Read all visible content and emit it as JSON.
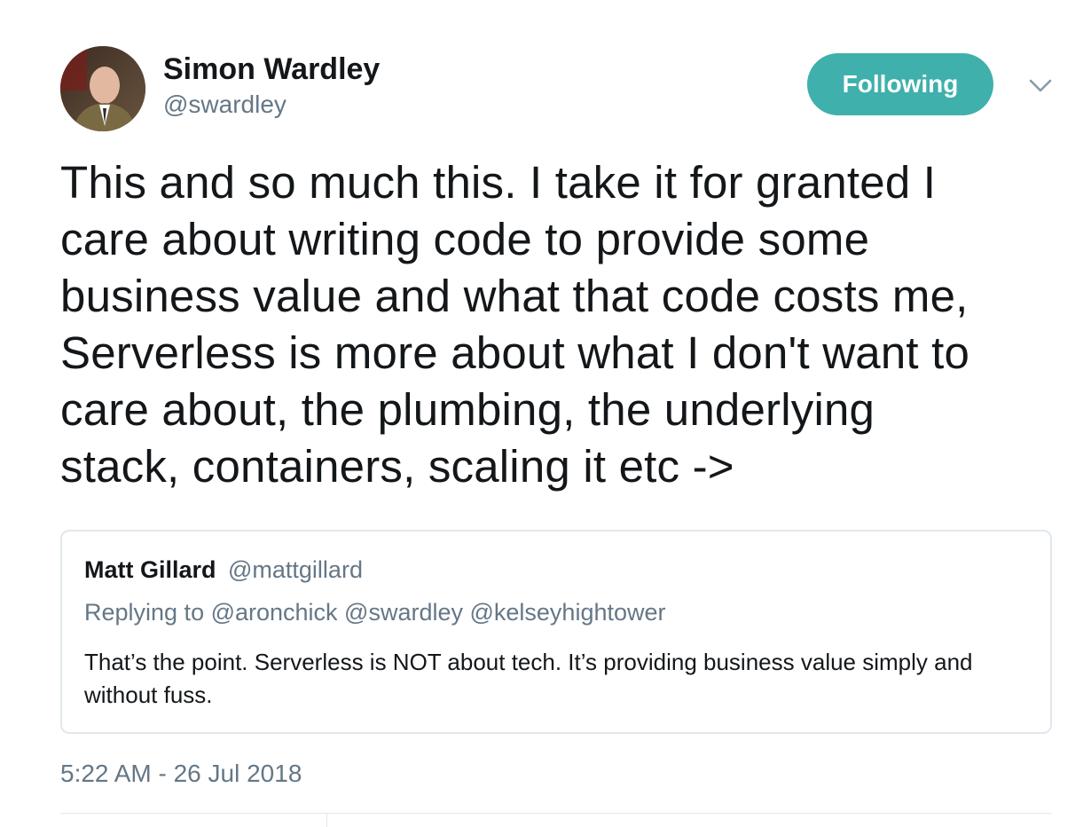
{
  "author": {
    "name": "Simon Wardley",
    "handle": "@swardley"
  },
  "follow_button": {
    "label": "Following",
    "color": "#3fb0ac"
  },
  "menu": {
    "icon": "chevron-down-icon"
  },
  "tweet": {
    "lines": [
      "This and so much this. I take it for granted I",
      "care about writing code to provide some",
      "business value and what that code costs me,",
      "Serverless is more about what I don't want to",
      "care about, the plumbing, the underlying",
      "stack, containers, scaling it etc ->"
    ]
  },
  "quoted_tweet": {
    "name": "Matt Gillard",
    "handle": "@mattgillard",
    "replying_to": "Replying to @aronchick @swardley @kelseyhightower",
    "text": "That’s the point. Serverless is NOT about tech. It’s providing business value simply and without fuss."
  },
  "timestamp": "5:22 AM - 26 Jul 2018",
  "colors": {
    "text": "#14171a",
    "secondary": "#657786",
    "border": "#e1e8ed"
  }
}
